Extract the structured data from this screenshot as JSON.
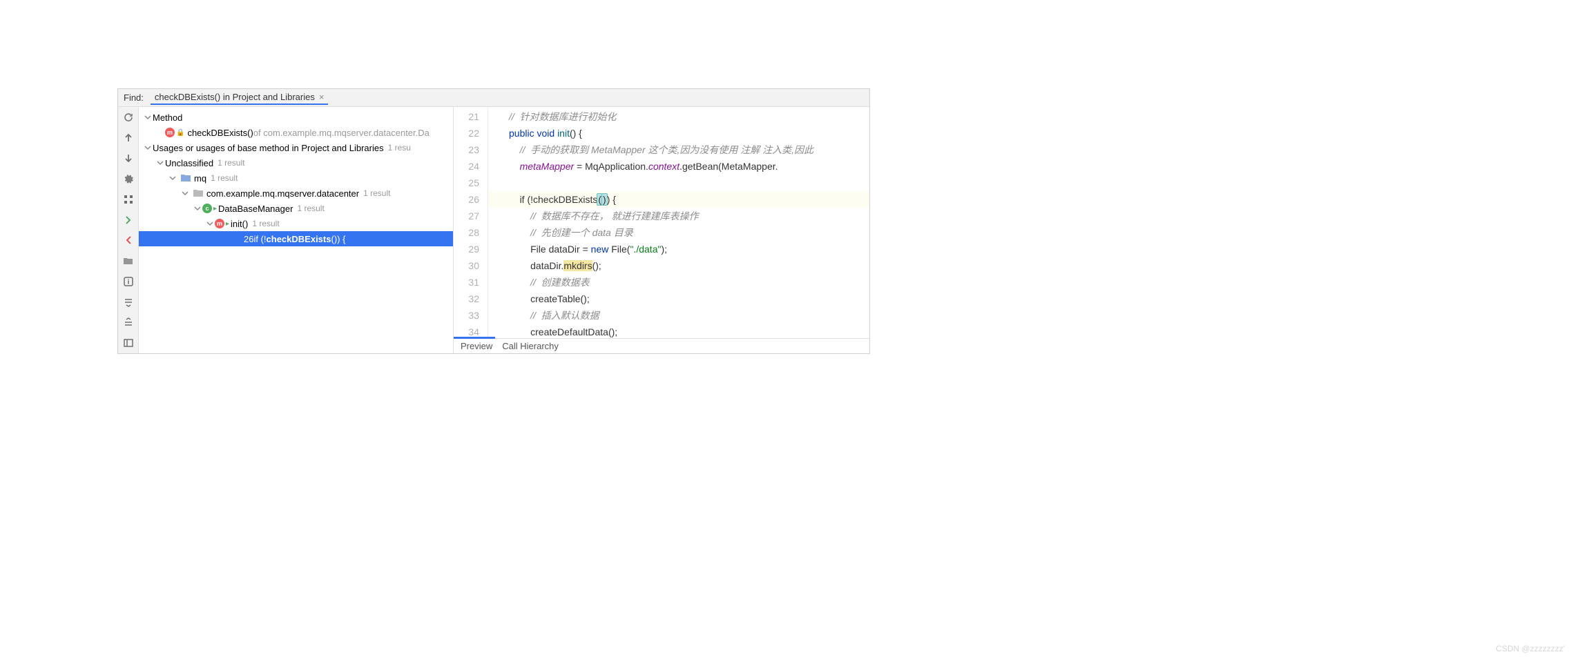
{
  "find": {
    "label": "Find:",
    "text": "checkDBExists() in Project and Libraries"
  },
  "tree": {
    "method_header": "Method",
    "method_item": {
      "name": "checkDBExists()",
      "context": " of com.example.mq.mqserver.datacenter.Da"
    },
    "usages_header": {
      "text": "Usages or usages of base method in Project and Libraries",
      "count": "1 resu"
    },
    "unclassified": {
      "label": "Unclassified",
      "count": "1 result"
    },
    "mq": {
      "label": "mq",
      "count": "1 result"
    },
    "package": {
      "label": "com.example.mq.mqserver.datacenter",
      "count": "1 result"
    },
    "class": {
      "label": "DataBaseManager",
      "count": "1 result"
    },
    "init": {
      "label": "init()",
      "count": "1 result"
    },
    "usage_line": {
      "num": "26",
      "prefix": " if (!",
      "bold": "checkDBExists",
      "suffix": "()) {"
    }
  },
  "code": {
    "lines": [
      "21",
      "22",
      "23",
      "24",
      "25",
      "26",
      "27",
      "28",
      "29",
      "30",
      "31",
      "32",
      "33",
      "34"
    ],
    "c21": "//  针对数据库进行初始化",
    "c22": {
      "kw1": "public",
      "kw2": "void",
      "name": "init",
      "rest": "() {"
    },
    "c23": "//  手动的获取到 MetaMapper 这个类,因为没有使用 注解 注入类,因此",
    "c24": {
      "field": "metaMapper",
      "eq": " = MqApplication.",
      "ctx": "context",
      "rest": ".getBean(MetaMapper."
    },
    "c26": {
      "pre": "if (!checkDBExists",
      "lp": "(",
      "rp": ")",
      "rest": ") {"
    },
    "c27": "//  数据库不存在， 就进行建建库表操作",
    "c28": "//  先创建一个 data 目录",
    "c29": {
      "pre": "File dataDir = ",
      "kw": "new",
      "mid": " File(",
      "str": "\"./data\"",
      "end": ");"
    },
    "c30": {
      "pre": "dataDir.",
      "hl": "mkdirs",
      "end": "();"
    },
    "c31": "//  创建数据表",
    "c32": "createTable();",
    "c33": "//  插入默认数据",
    "c34": "createDefaultData();"
  },
  "footer": {
    "preview": "Preview",
    "call": "Call Hierarchy"
  },
  "watermark": "CSDN @zzzzzzzz'"
}
